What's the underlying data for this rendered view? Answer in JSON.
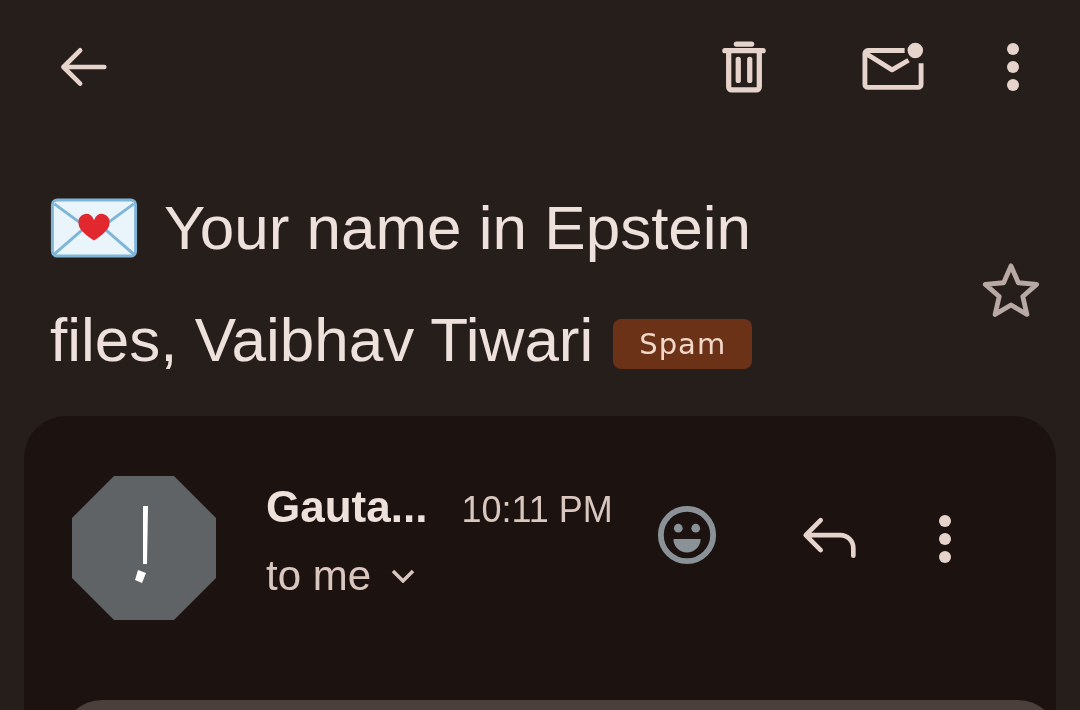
{
  "subject": {
    "lines": [
      "Your name in Epstein",
      "files, Vaibhav Tiwari"
    ],
    "label": "Spam",
    "starred": false
  },
  "message": {
    "sender": "Gauta...",
    "time": "10:11 PM",
    "recipient": "to me"
  }
}
